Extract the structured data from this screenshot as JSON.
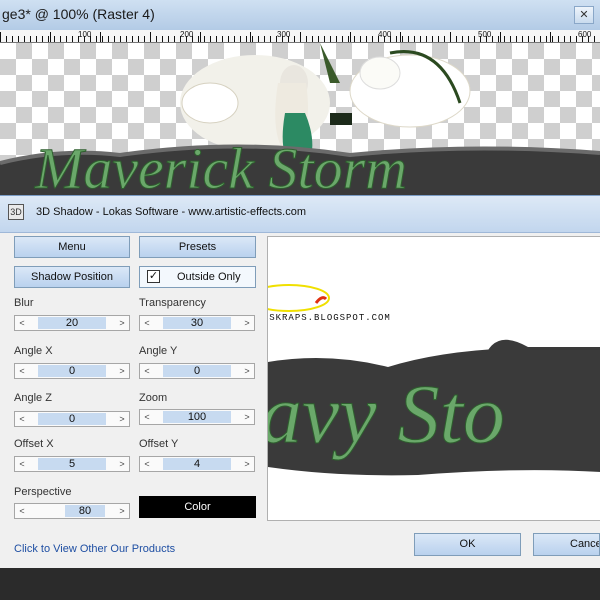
{
  "document": {
    "title": "ge3* @ 100% (Raster 4)",
    "close_glyph": "✕",
    "ruler_labels": [
      "100",
      "200",
      "300",
      "400",
      "500",
      "600"
    ],
    "canvas_text": "Maverick Storm"
  },
  "dialog": {
    "title": "3D Shadow - Lokas Software - www.artistic-effects.com",
    "icon": "3D",
    "buttons": {
      "menu": "Menu",
      "presets": "Presets",
      "shadow_position": "Shadow Position",
      "color": "Color",
      "ok": "OK",
      "cancel": "Cancel"
    },
    "outside_only": {
      "label": "Outside Only",
      "checked": true,
      "mark": "✓"
    },
    "controls": [
      {
        "label": "Blur",
        "value": "20"
      },
      {
        "label": "Transparency",
        "value": "30"
      },
      {
        "label": "Angle X",
        "value": "0"
      },
      {
        "label": "Angle Y",
        "value": "0"
      },
      {
        "label": "Angle Z",
        "value": "0"
      },
      {
        "label": "Zoom",
        "value": "100"
      },
      {
        "label": "Offset X",
        "value": "5"
      },
      {
        "label": "Offset Y",
        "value": "4"
      },
      {
        "label": "Perspective",
        "value": "80"
      }
    ],
    "spin_left": "<",
    "spin_right": ">",
    "link": "Click to View Other Our Products",
    "preview": {
      "watermark": "© LC MAVERICKSKRAPS.BLOGSPOT.COM",
      "text": "avy Sto"
    }
  }
}
